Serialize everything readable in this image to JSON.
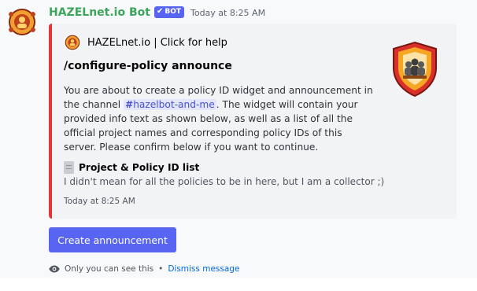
{
  "message": {
    "author": {
      "name": "HAZELnet.io Bot",
      "bot_tag": "BOT"
    },
    "timestamp": "Today at 8:25 AM"
  },
  "embed": {
    "author_name": "HAZELnet.io | Click for help",
    "title": "/configure-policy announce",
    "description_before": "You are about to create a policy ID widget and announcement in the channel ",
    "channel_mention": "hazelbot-and-me",
    "description_after": ". The widget will contain your provided info text as shown below, as well as a list of all the official project names and corresponding policy IDs of this server. Please confirm below if you want to continue.",
    "field": {
      "name": "Project & Policy ID list",
      "value": "I didn't mean for all the policies to be in here, but I am a collector ;)"
    },
    "footer_timestamp": "Today at 8:25 AM",
    "accent_color": "#e03838"
  },
  "button": {
    "label": "Create announcement",
    "color": "#5865f2"
  },
  "ephemeral": {
    "text": "Only you can see this",
    "separator": "•",
    "dismiss_label": "Dismiss message"
  },
  "icons": {
    "avatar": "hazelnet-logo-icon",
    "verified": "checkmark-icon",
    "thumbnail": "shield-crest-icon",
    "field": "document-icon",
    "visibility": "eye-icon"
  },
  "colors": {
    "username": "#3ba55c",
    "bot_tag": "#5865f2",
    "link": "#0068e0"
  }
}
